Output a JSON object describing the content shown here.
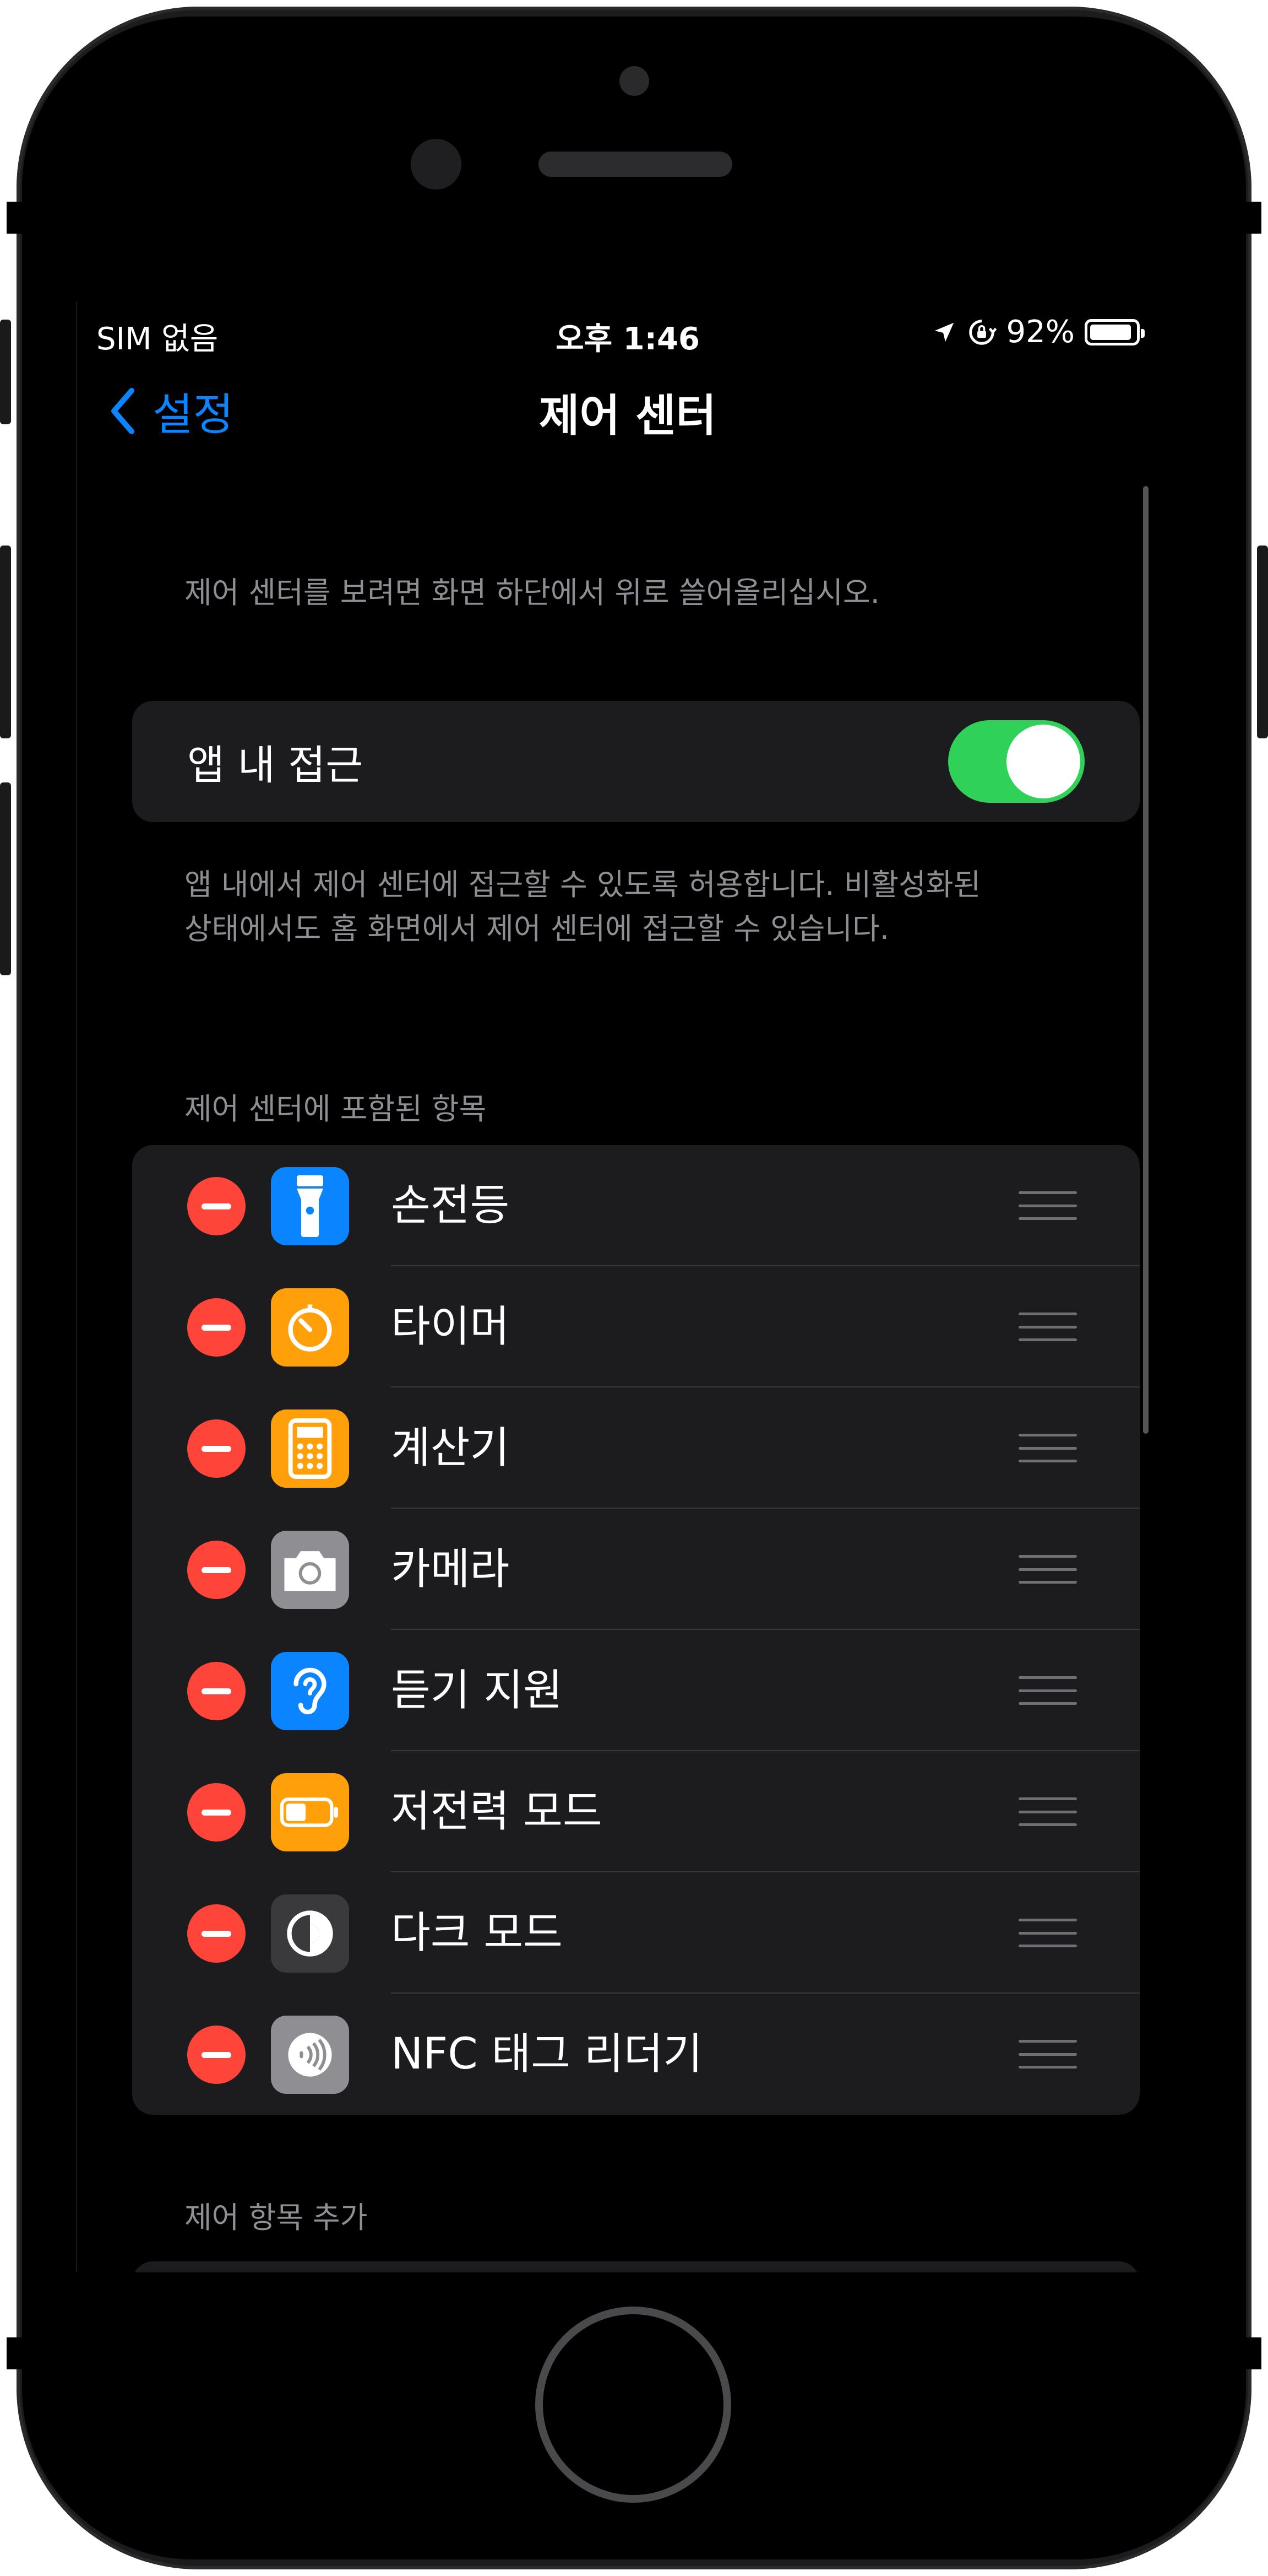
{
  "status_bar": {
    "carrier": "SIM 없음",
    "time": "오후 1:46",
    "battery": "92%",
    "battery_level": 0.92
  },
  "nav": {
    "back_label": "설정",
    "title": "제어 센터"
  },
  "intro_text": "제어 센터를 보려면 화면 하단에서 위로 쓸어올리십시오.",
  "access_toggle": {
    "label": "앱 내 접근",
    "on": true,
    "footer_line1": "앱 내에서 제어 센터에 접근할 수 있도록 허용합니다. 비활성화된",
    "footer_line2": "상태에서도 홈 화면에서 제어 센터에 접근할 수 있습니다."
  },
  "included_header": "제어 센터에 포함된 항목",
  "included_items": [
    {
      "label": "손전등",
      "icon": "flashlight-icon",
      "color": "#0a84ff"
    },
    {
      "label": "타이머",
      "icon": "timer-icon",
      "color": "#ff9f0a"
    },
    {
      "label": "계산기",
      "icon": "calculator-icon",
      "color": "#ff9f0a"
    },
    {
      "label": "카메라",
      "icon": "camera-icon",
      "color": "#8e8e93"
    },
    {
      "label": "듣기 지원",
      "icon": "ear-icon",
      "color": "#0a84ff"
    },
    {
      "label": "저전력 모드",
      "icon": "battery-icon",
      "color": "#ff9f0a"
    },
    {
      "label": "다크 모드",
      "icon": "dark-mode-icon",
      "color": "#3a3a3c"
    },
    {
      "label": "NFC 태그 리더기",
      "icon": "nfc-icon",
      "color": "#8e8e93"
    }
  ],
  "more_header": "제어 항목 추가",
  "colors": {
    "accent": "#0a84ff",
    "toggle_on": "#30d158",
    "remove": "#ff453a"
  }
}
